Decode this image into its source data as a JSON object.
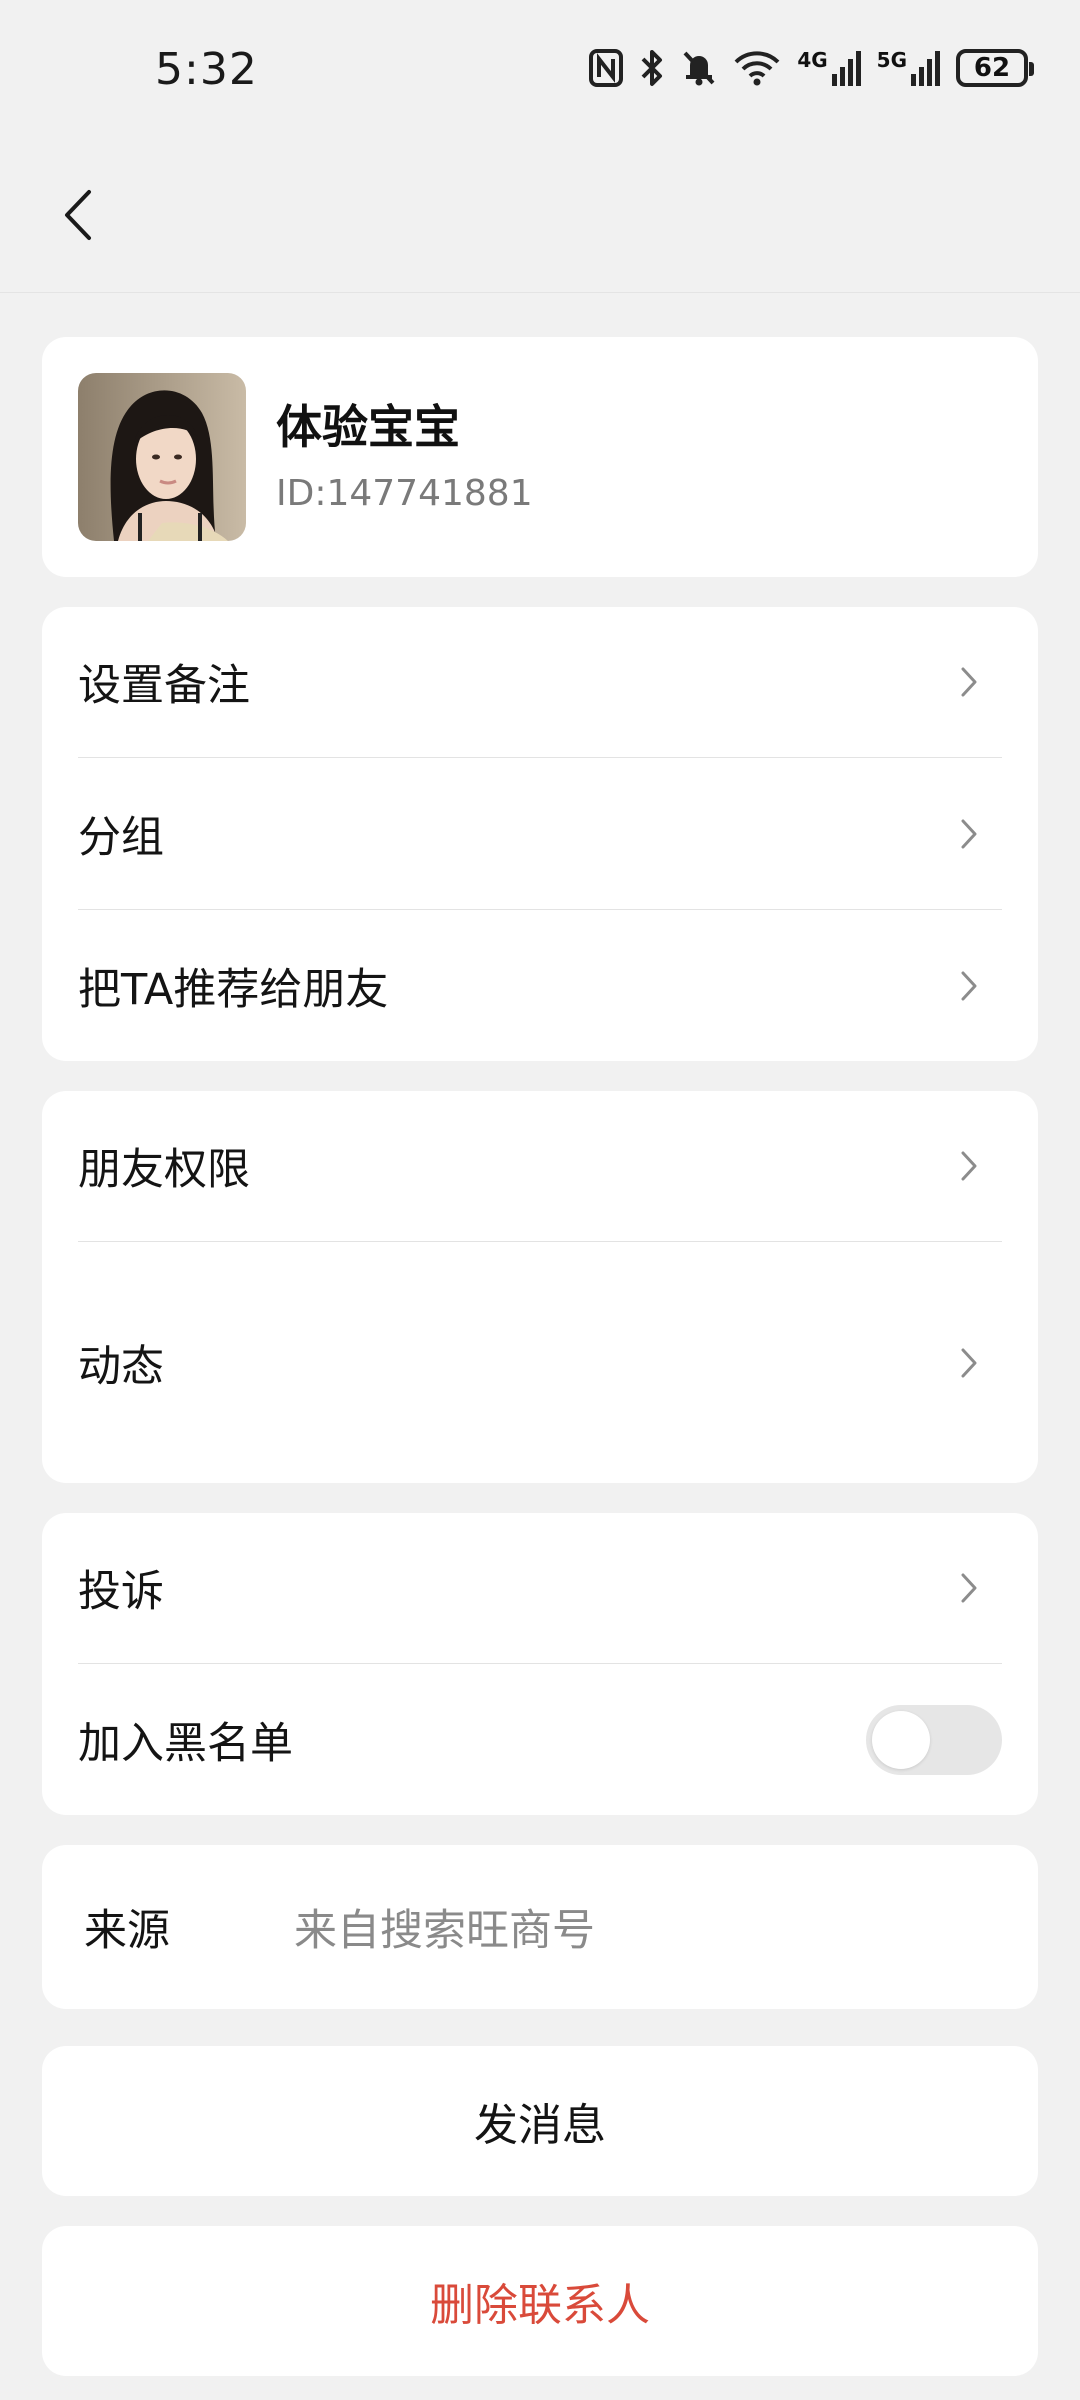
{
  "status_bar": {
    "time": "5:32",
    "network_4g": "4G",
    "network_5g": "5G",
    "battery_level": "62",
    "icons": [
      "nfc-icon",
      "bluetooth-icon",
      "mute-bell-icon",
      "wifi-icon",
      "signal-4g-icon",
      "signal-5g-icon",
      "battery-icon"
    ]
  },
  "header": {
    "back_icon": "chevron-left-icon"
  },
  "profile": {
    "name": "体验宝宝",
    "id": "ID:147741881"
  },
  "group1": {
    "items": [
      {
        "label": "设置备注",
        "icon": "chevron-right-icon"
      },
      {
        "label": "分组",
        "icon": "chevron-right-icon"
      },
      {
        "label": "把TA推荐给朋友",
        "icon": "chevron-right-icon"
      }
    ]
  },
  "group2": {
    "items": [
      {
        "label": "朋友权限",
        "icon": "chevron-right-icon"
      },
      {
        "label": "动态",
        "icon": "chevron-right-icon"
      }
    ]
  },
  "group3": {
    "complain_label": "投诉",
    "blacklist_label": "加入黑名单",
    "blacklist_enabled": false
  },
  "source": {
    "label": "来源",
    "value": "来自搜索旺商号"
  },
  "actions": {
    "send_message": "发消息",
    "delete_contact": "删除联系人"
  },
  "colors": {
    "background": "#f1f1f1",
    "card": "#ffffff",
    "danger": "#d94a3a",
    "secondary_text": "#8a8a8a"
  }
}
